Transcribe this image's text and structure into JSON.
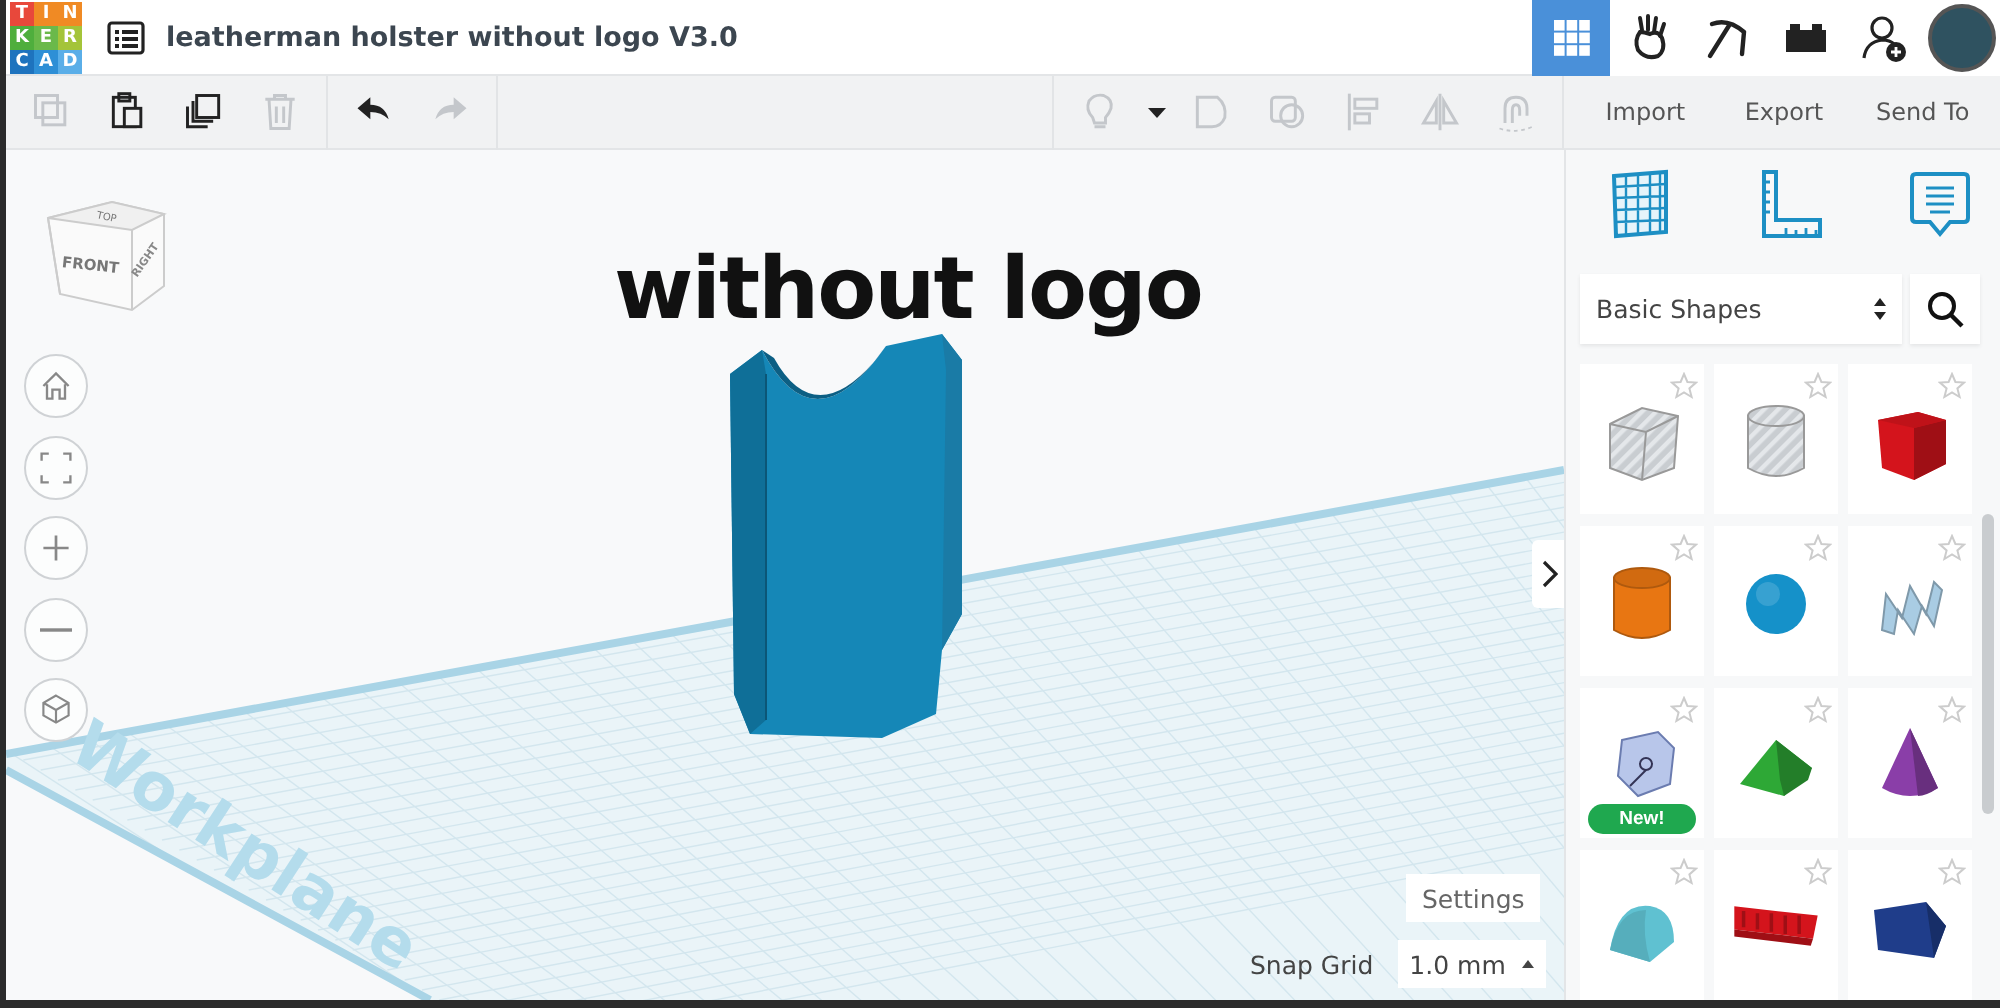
{
  "app": {
    "logo_letters": [
      "T",
      "I",
      "N",
      "K",
      "E",
      "R",
      "C",
      "A",
      "D"
    ],
    "title": "leatherman holster without logo V3.0"
  },
  "nav": [
    {
      "kind": "grid",
      "selected": true
    },
    {
      "kind": "hand",
      "selected": false
    },
    {
      "kind": "pickaxe",
      "selected": false
    },
    {
      "kind": "brick",
      "selected": false
    },
    {
      "kind": "add-user",
      "selected": false
    },
    {
      "kind": "avatar",
      "selected": false
    }
  ],
  "toolbar": {
    "edit_tools": [
      {
        "kind": "copy",
        "disabled": true
      },
      {
        "kind": "paste",
        "disabled": false
      },
      {
        "kind": "duplicate",
        "disabled": false
      },
      {
        "kind": "delete",
        "disabled": true
      },
      {
        "kind": "undo",
        "disabled": false
      },
      {
        "kind": "redo",
        "disabled": true
      }
    ],
    "shape_tools": [
      {
        "kind": "bulb",
        "disabled": true
      },
      {
        "kind": "caret",
        "disabled": false
      },
      {
        "kind": "group",
        "disabled": true
      },
      {
        "kind": "ungroup",
        "disabled": true
      },
      {
        "kind": "align",
        "disabled": true
      },
      {
        "kind": "mirror",
        "disabled": true
      },
      {
        "kind": "magnet",
        "disabled": true
      }
    ],
    "actions": [
      "Import",
      "Export",
      "Send To"
    ]
  },
  "view_cube": {
    "top": "TOP",
    "front": "FRONT",
    "right": "RIGHT"
  },
  "view_controls": [
    {
      "kind": "home"
    },
    {
      "kind": "fit"
    },
    {
      "kind": "zoom-in"
    },
    {
      "kind": "zoom-out"
    },
    {
      "kind": "ortho"
    }
  ],
  "scene": {
    "text_object": "without logo",
    "workplane_label": "Workplane"
  },
  "settings_button": "Settings",
  "snap_grid": {
    "label": "Snap Grid",
    "value": "1.0 mm"
  },
  "panel": {
    "tools": [
      {
        "kind": "workplane"
      },
      {
        "kind": "ruler"
      },
      {
        "kind": "notes"
      }
    ],
    "library": "Basic Shapes",
    "shapes": [
      {
        "kind": "box-hole",
        "color": "#c9cdd1"
      },
      {
        "kind": "cylinder-hole",
        "color": "#c9cdd1"
      },
      {
        "kind": "box",
        "color": "#d4141c"
      },
      {
        "kind": "cylinder",
        "color": "#e87612"
      },
      {
        "kind": "sphere",
        "color": "#1591c9"
      },
      {
        "kind": "scribble",
        "color": "#a9cce3"
      },
      {
        "kind": "sketch",
        "color": "#b8c6ea",
        "badge": "New!"
      },
      {
        "kind": "roof",
        "color": "#2ea836"
      },
      {
        "kind": "cone",
        "color": "#8a3ea8"
      },
      {
        "kind": "round-roof",
        "color": "#5fc1d1"
      },
      {
        "kind": "text-shape",
        "color": "#d4141c"
      },
      {
        "kind": "polygon",
        "color": "#1f3d8a"
      }
    ]
  }
}
